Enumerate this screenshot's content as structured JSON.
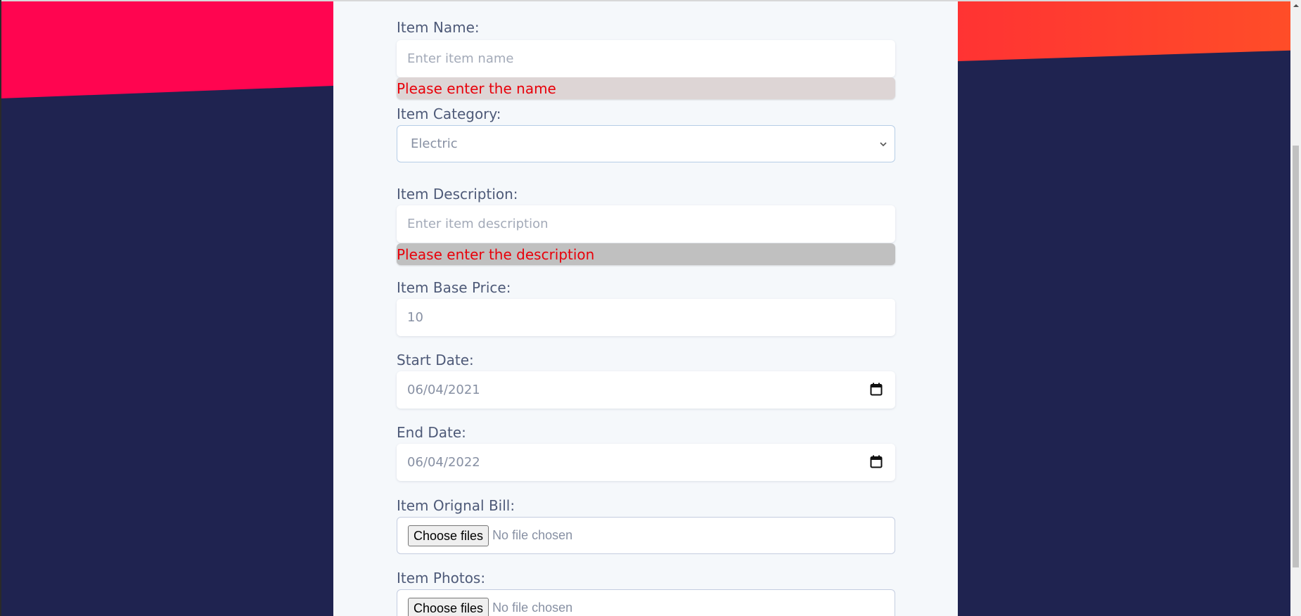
{
  "form": {
    "item_name": {
      "label": "Item Name:",
      "placeholder": "Enter item name",
      "error": "Please enter the name"
    },
    "item_category": {
      "label": "Item Category:",
      "selected": "Electric"
    },
    "item_description": {
      "label": "Item Description:",
      "placeholder": "Enter item description",
      "error": "Please enter the description"
    },
    "item_base_price": {
      "label": "Item Base Price:",
      "value": "10"
    },
    "start_date": {
      "label": "Start Date:",
      "value": "06/04/2021"
    },
    "end_date": {
      "label": "End Date:",
      "value": "06/04/2022"
    },
    "item_original_bill": {
      "label": "Item Orignal Bill:",
      "button": "Choose files",
      "status": "No file chosen"
    },
    "item_photos": {
      "label": "Item Photos:",
      "button": "Choose files",
      "status": "No file chosen"
    }
  },
  "icons": {
    "calendar": "calendar-icon",
    "select_arrow": "chevron-down-icon",
    "scroll_up": "scroll-up-arrow-icon"
  },
  "colors": {
    "page_background": "#1f2350",
    "accent_left": "#ff0550",
    "accent_right": "#ff4d28",
    "panel_background": "#f5f8fb",
    "error_text": "#e8000a",
    "label_text": "#4e5a78"
  }
}
